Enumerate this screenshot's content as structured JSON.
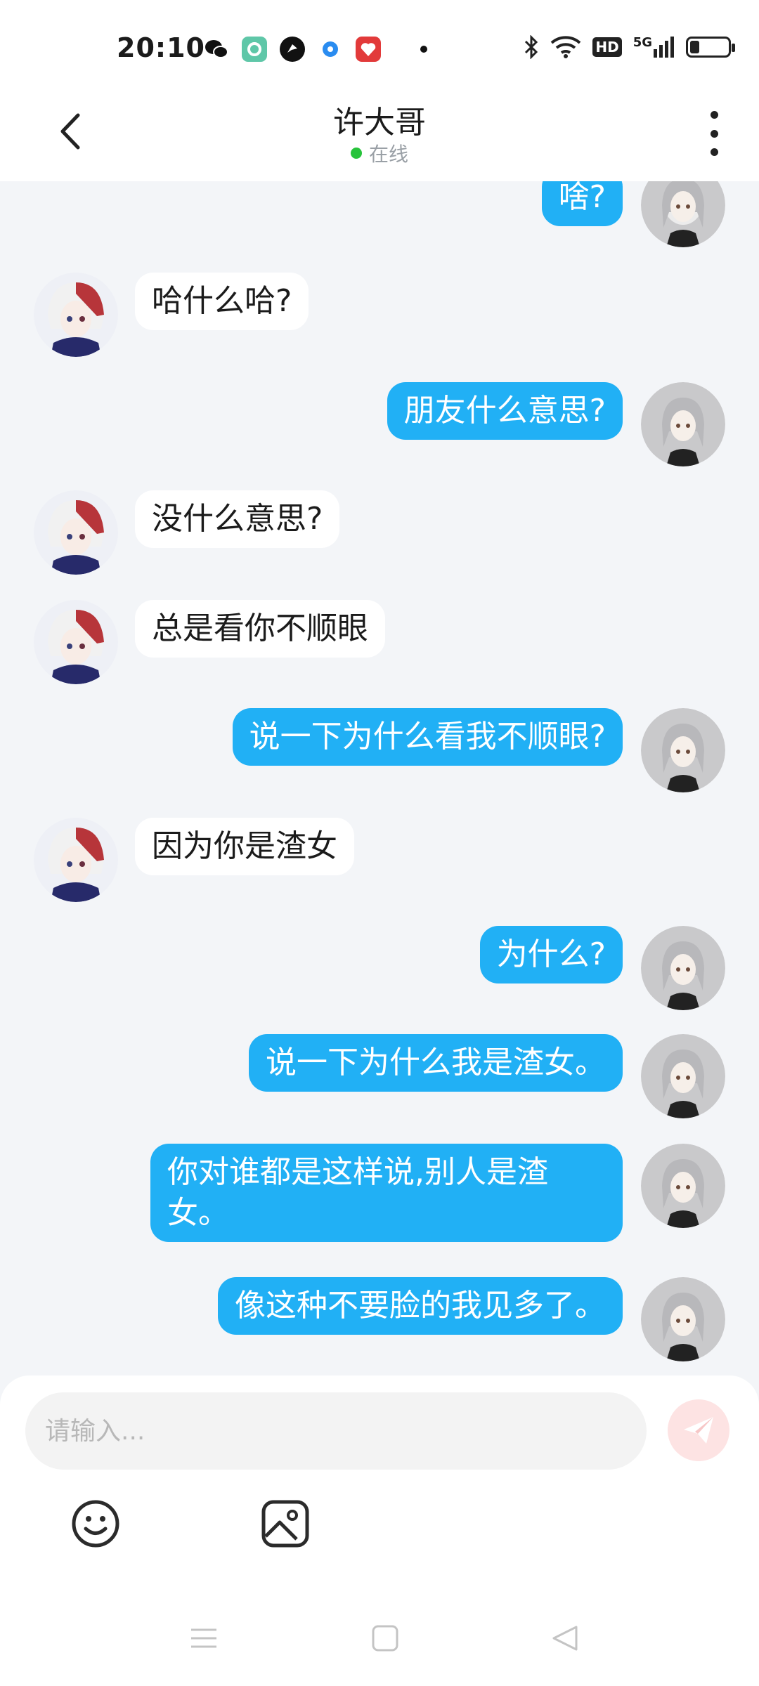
{
  "status_bar": {
    "time": "20:10",
    "app_icons": [
      "wechat-icon",
      "green-app-icon",
      "bird-app-icon",
      "blue-dot-app-icon",
      "red-app-icon"
    ],
    "signal_labels": {
      "hd": "HD",
      "net": "5G"
    },
    "battery_level": 0.25
  },
  "header": {
    "title": "许大哥",
    "status": "在线",
    "status_color": "#27c33b"
  },
  "colors": {
    "outgoing_bubble": "#21b0f5",
    "incoming_bubble": "#ffffff",
    "background": "#f3f5f8"
  },
  "messages": [
    {
      "from": "me",
      "text": "啥?"
    },
    {
      "from": "them",
      "text": "哈什么哈?"
    },
    {
      "from": "me",
      "text": "朋友什么意思?"
    },
    {
      "from": "them",
      "text": "没什么意思?"
    },
    {
      "from": "them",
      "text": "总是看你不顺眼"
    },
    {
      "from": "me",
      "text": "说一下为什么看我不顺眼?"
    },
    {
      "from": "them",
      "text": "因为你是渣女"
    },
    {
      "from": "me",
      "text": "为什么?"
    },
    {
      "from": "me",
      "text": "说一下为什么我是渣女。"
    },
    {
      "from": "me",
      "text": "你对谁都是这样说,别人是渣女。"
    },
    {
      "from": "me",
      "text": "像这种不要脸的我见多了。"
    }
  ],
  "composer": {
    "placeholder": "请输入...",
    "value": ""
  },
  "toolbar": {
    "emoji_icon": "smiley-icon",
    "image_icon": "image-icon"
  },
  "navbar": {
    "icons": [
      "menu-icon",
      "home-icon",
      "back-triangle-icon"
    ]
  }
}
